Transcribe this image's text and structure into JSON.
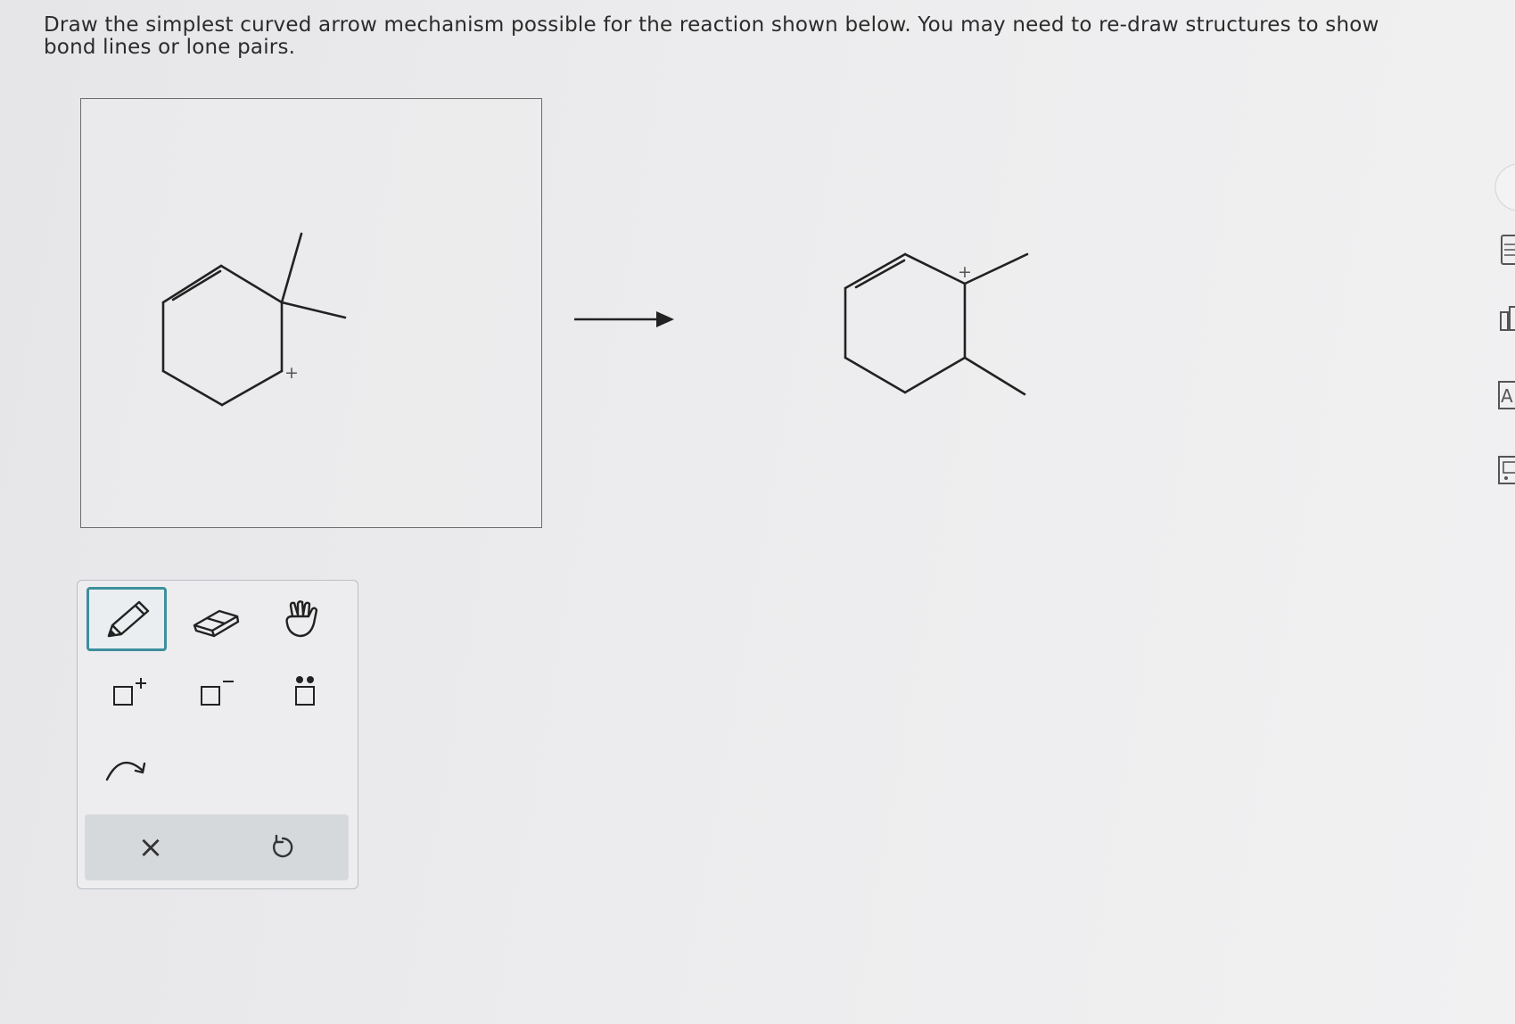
{
  "question": {
    "text": "Draw the simplest curved arrow mechanism possible for the reaction shown below. You may need to re-draw structures to show bond lines or lone pairs."
  },
  "reactant": {
    "charge_label": "+"
  },
  "product": {
    "charge_label": "+"
  },
  "tools": [
    {
      "name": "pencil-tool",
      "selected": true
    },
    {
      "name": "eraser-tool",
      "selected": false
    },
    {
      "name": "pan-hand-tool",
      "selected": false
    },
    {
      "name": "positive-charge-tool",
      "label": "+",
      "selected": false
    },
    {
      "name": "negative-charge-tool",
      "label": "−",
      "selected": false
    },
    {
      "name": "lone-pair-tool",
      "selected": false
    },
    {
      "name": "curved-arrow-tool",
      "selected": false
    }
  ],
  "actions": {
    "clear_label": "×"
  },
  "sidebar": {
    "partial_labels": [
      "A"
    ]
  },
  "colors": {
    "accent": "#3e8f9c",
    "line": "#222222"
  }
}
